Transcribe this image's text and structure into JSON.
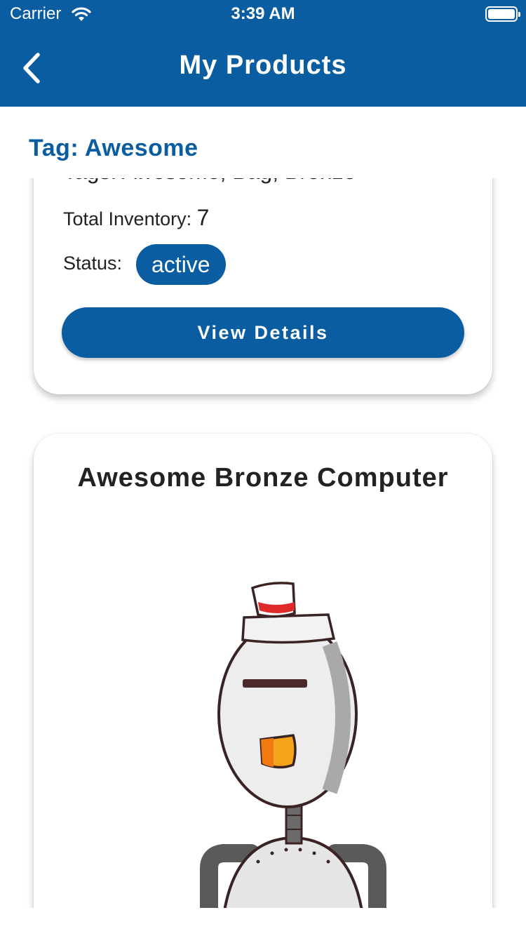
{
  "status_bar": {
    "carrier": "Carrier",
    "time": "3:39 AM"
  },
  "header": {
    "title": "My Products",
    "back_icon": "chevron-left-icon"
  },
  "section": {
    "title": "Tag: Awesome"
  },
  "products": [
    {
      "tags_label": "Tags: Awesome, Bag, Bronze",
      "inventory_label": "Total Inventory:",
      "inventory_value": "7",
      "status_label": "Status:",
      "status_value": "active",
      "action_label": "View Details"
    },
    {
      "title": "Awesome Bronze Computer",
      "image": "robot-illustration"
    }
  ],
  "colors": {
    "primary": "#0a5da0",
    "text": "#222222",
    "background": "#ffffff"
  }
}
